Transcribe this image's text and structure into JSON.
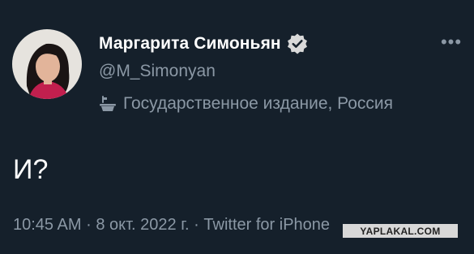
{
  "user": {
    "display_name": "Маргарита Симоньян",
    "handle": "@M_Simonyan",
    "verified_icon": "verified-badge-icon",
    "label": "Государственное издание, Россия",
    "label_icon": "state-media-icon"
  },
  "more_icon": "more-options-icon",
  "tweet": {
    "text": "И?",
    "time": "10:45 AM",
    "separator1": "·",
    "date": "8 окт. 2022 г.",
    "separator2": "·",
    "source": "Twitter for iPhone"
  },
  "watermark": "YAPLAKAL.COM",
  "colors": {
    "background": "#15202b",
    "primary_text": "#ffffff",
    "secondary_text": "#8b98a5"
  }
}
